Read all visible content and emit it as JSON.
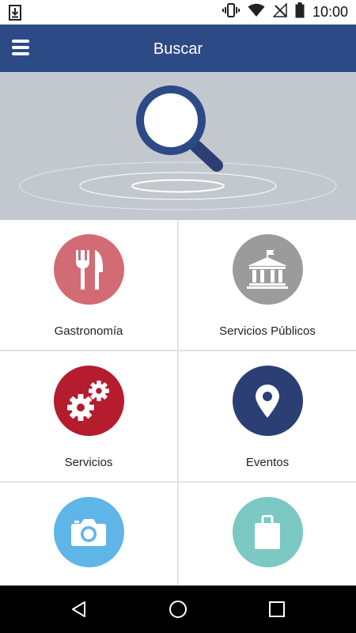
{
  "status_bar": {
    "time": "10:00",
    "icons": [
      "download-icon",
      "vibrate-icon",
      "wifi-icon",
      "no-signal-icon",
      "battery-icon"
    ]
  },
  "app_bar": {
    "title": "Buscar",
    "menu_icon": "hamburger-menu-icon"
  },
  "hero": {
    "icon": "search-magnifier-icon"
  },
  "categories": [
    {
      "label": "Gastronomía",
      "icon": "fork-knife-icon",
      "color": "#d26b73"
    },
    {
      "label": "Servicios Públicos",
      "icon": "government-building-icon",
      "color": "#9b9b9b"
    },
    {
      "label": "Servicios",
      "icon": "gears-icon",
      "color": "#b51c2e"
    },
    {
      "label": "Eventos",
      "icon": "location-pin-icon",
      "color": "#2c3f74"
    },
    {
      "label": "",
      "icon": "camera-icon",
      "color": "#5fb4e8"
    },
    {
      "label": "",
      "icon": "shopping-bag-icon",
      "color": "#7cc8c2"
    }
  ],
  "nav_bar": {
    "buttons": [
      "back-icon",
      "home-icon",
      "recents-icon"
    ]
  },
  "colors": {
    "primary": "#2c4a86",
    "hero_bg": "#c3c8cf"
  }
}
